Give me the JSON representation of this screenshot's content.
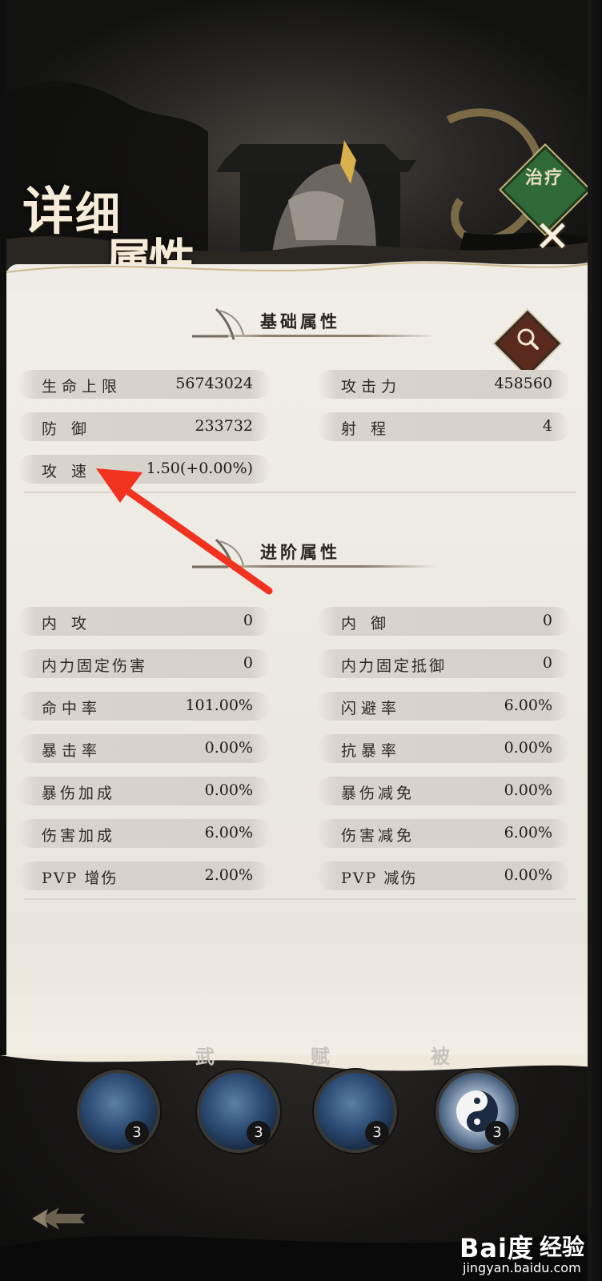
{
  "header": {
    "title_chars": [
      "详",
      "细",
      "属",
      "性"
    ],
    "badge_label": "治疗",
    "close_glyph": "✕"
  },
  "basic": {
    "title": "基础属性",
    "rows": [
      {
        "left_label": "生命上限",
        "left_value": "56743024",
        "right_label": "攻击力",
        "right_value": "458560"
      },
      {
        "left_label": "防 御",
        "left_value": "233732",
        "right_label": "射 程",
        "right_value": "4"
      },
      {
        "left_label": "攻 速",
        "left_value": "1.50(+0.00%)"
      }
    ]
  },
  "advanced": {
    "title": "进阶属性",
    "rows": [
      {
        "left_label": "内 攻",
        "left_value": "0",
        "right_label": "内 御",
        "right_value": "0"
      },
      {
        "left_label": "内力固定伤害",
        "left_value": "0",
        "right_label": "内力固定抵御",
        "right_value": "0"
      },
      {
        "left_label": "命中率",
        "left_value": "101.00%",
        "right_label": "闪避率",
        "right_value": "6.00%"
      },
      {
        "left_label": "暴击率",
        "left_value": "0.00%",
        "right_label": "抗暴率",
        "right_value": "0.00%"
      },
      {
        "left_label": "暴伤加成",
        "left_value": "0.00%",
        "right_label": "暴伤减免",
        "right_value": "0.00%"
      },
      {
        "left_label": "伤害加成",
        "left_value": "6.00%",
        "right_label": "伤害减免",
        "right_value": "6.00%"
      },
      {
        "left_label": "PVP 增伤",
        "left_value": "2.00%",
        "right_label": "PVP 减伤",
        "right_value": "0.00%"
      }
    ]
  },
  "skills": [
    {
      "tag": "",
      "count": "3"
    },
    {
      "tag": "武",
      "count": "3"
    },
    {
      "tag": "赋",
      "count": "3"
    },
    {
      "tag": "被",
      "count": "3"
    }
  ],
  "watermark": {
    "logo": "Bai度",
    "text": "经验",
    "url": "jingyan.baidu.com"
  },
  "colors": {
    "panel": "#efece5",
    "annotation_arrow": "#f0321f",
    "badge_green": "#2f6a38"
  }
}
